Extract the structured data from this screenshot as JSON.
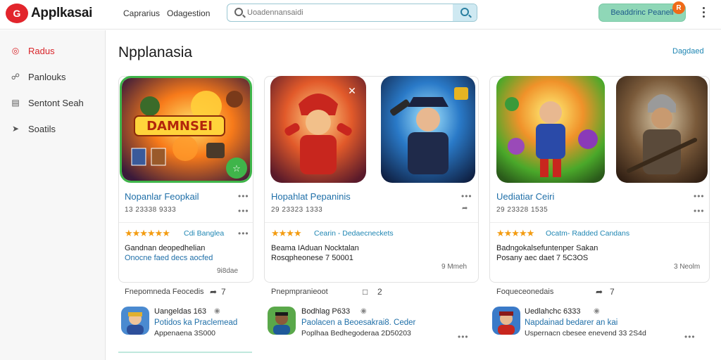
{
  "app": {
    "brand": "Applkasai",
    "logo_text": "G",
    "nav": [
      "Caprarius",
      "Odagestion"
    ],
    "search_placeholder": "Uoadennansaidi",
    "cta_label": "Beaddrinc Peanell",
    "cta_badge": "R"
  },
  "sidebar": {
    "items": [
      {
        "label": "Radus",
        "icon": "radar-icon",
        "active": true
      },
      {
        "label": "Panlouks",
        "icon": "shield-icon",
        "active": false
      },
      {
        "label": "Sentont Seah",
        "icon": "document-icon",
        "active": false
      },
      {
        "label": "Soatils",
        "icon": "share-icon",
        "active": false
      }
    ]
  },
  "main": {
    "title": "Npplanasia",
    "link": "Dagdaed"
  },
  "cards": [
    {
      "title": "Nopanlar Feopkail",
      "meta": "13 23338 9333",
      "rating_label": "Cdi Banglea",
      "desc1": "Gandnan deopedhelian",
      "desc2": "Onocne faed decs aocfed",
      "count": "9i8dae",
      "section": "Fnepomneda Feocedis",
      "action_count": "7",
      "reviewer": {
        "name": "Uangeldas 163",
        "line": "Potidos ka Praclemead",
        "meta": "Appenaena 3S000"
      }
    },
    {
      "title": "Hopahlat Pepaninis",
      "meta": "29 23323 1333",
      "rating_label": "Cearin - Dedaecneckets",
      "desc1": "Beama IAduan Nocktalan",
      "desc2": "Rosqpheonese 7 50001",
      "count": "9 Mmeh",
      "section": "Pnepmpranieoot",
      "action_count": "2",
      "reviewer": {
        "name": "Bodhlag P633",
        "line": "Paolacen a Beoesakrai8. Ceder",
        "meta": "Poplhaa Bedhegoderaa 2D50203"
      }
    },
    {
      "title": "Uediatiar Ceiri",
      "meta": "29 23328 1535",
      "rating_label": "Ocatm- Radded Candans",
      "desc1": "Badngokalsefuntenper Sakan",
      "desc2": "Posany aec daet 7 5C3OS",
      "count": "3 Neolm",
      "section": "Foqueceonedais",
      "action_count": "7",
      "reviewer": {
        "name": "Uedlahchc 6333",
        "line": "Napdainad bedarer an kai",
        "meta": "Uspernacn cbesee enevend 33 2S4d"
      }
    }
  ]
}
